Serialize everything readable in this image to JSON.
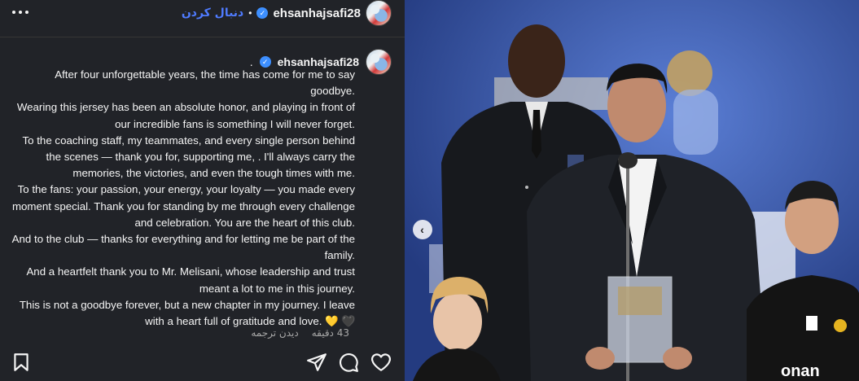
{
  "header": {
    "username": "ehsanhajsafi28",
    "separator": "•",
    "follow_label": "دنبال کردن",
    "more_icon": "more-horizontal-icon"
  },
  "caption": {
    "username": "ehsanhajsafi28",
    "trailing": ".",
    "lines": [
      "After four unforgettable years, the time has come for me to say goodbye.",
      "Wearing this jersey has been an absolute honor, and playing in front of our incredible fans is something I will never forget.",
      "To the coaching staff, my teammates, and every single person behind the scenes — thank you for, supporting me, . I'll always carry the memories, the victories, and even the tough times with me.",
      "To the fans: your passion, your energy, your loyalty — you made every moment special. Thank you for standing by me through every challenge and celebration. You are the heart of this club.",
      "And to the club — thanks for everything and for letting me be part of the family.",
      "And a heartfelt thank you to Mr. Melisani, whose leadership and trust meant a lot to me in this journey.",
      "This is not a goodbye forever, but a new chapter in my journey. I leave with a full heart of gratitude and love."
    ],
    "final_line_start": "This is not a goodbye forever, but a new chapter in my journey. I leave with a heart full of gratitude and love.",
    "heart_yellow": "💛",
    "heart_black": "🖤"
  },
  "meta": {
    "time": "43 دقیقه",
    "translate": "دیدن ترجمه"
  },
  "actions": {
    "bookmark_icon": "bookmark-icon",
    "share_icon": "send-icon",
    "comment_icon": "comment-icon",
    "like_icon": "heart-icon"
  },
  "media": {
    "prev_arrow": "‹",
    "colors": {
      "background": "#2f4a94",
      "suit": "#1e2126",
      "shirt": "#f2f2f2"
    }
  }
}
